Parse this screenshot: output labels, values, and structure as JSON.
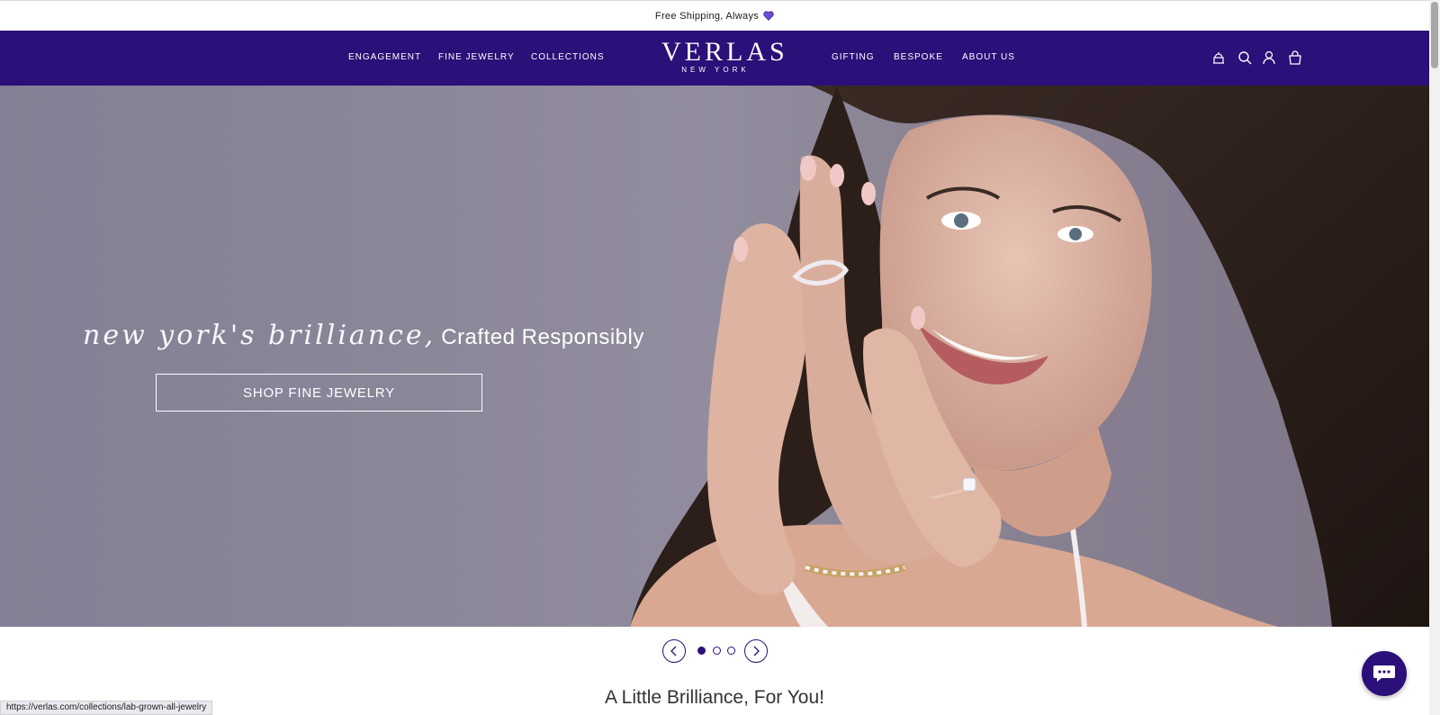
{
  "announcement": {
    "text": "Free Shipping, Always"
  },
  "nav": {
    "left": [
      "ENGAGEMENT",
      "FINE JEWELRY",
      "COLLECTIONS"
    ],
    "right": [
      "GIFTING",
      "BESPOKE",
      "ABOUT US"
    ],
    "logo": {
      "main": "VERLAS",
      "sub": "NEW YORK"
    },
    "icons": [
      "store-icon",
      "search-icon",
      "account-icon",
      "bag-icon"
    ]
  },
  "hero": {
    "script_text": "new york's brilliance,",
    "plain_text": "Crafted Responsibly",
    "cta": "SHOP FINE JEWELRY"
  },
  "carousel": {
    "active_index": 0,
    "slides": 3
  },
  "section": {
    "title": "A Little Brilliance, For You!"
  },
  "status_url": "https://verlas.com/collections/lab-grown-all-jewelry",
  "colors": {
    "brand": "#2a1078",
    "heart": "#6b4bd1",
    "hero_bg": "#8c8699"
  }
}
